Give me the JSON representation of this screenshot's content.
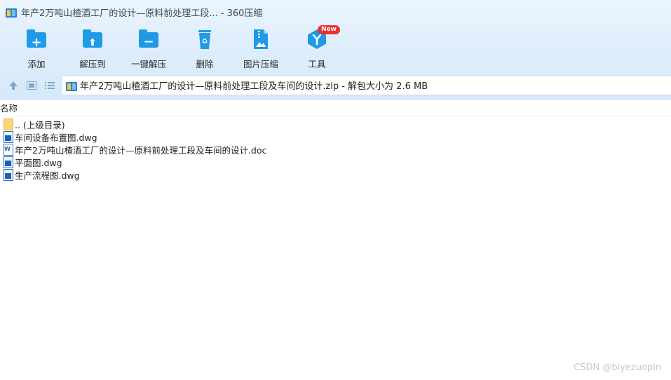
{
  "window": {
    "title": "年产2万吨山楂酒工厂的设计—原料前处理工段... - 360压缩"
  },
  "toolbar": {
    "items": [
      {
        "label": "添加",
        "icon": "add-folder-icon"
      },
      {
        "label": "解压到",
        "icon": "extract-to-folder-icon"
      },
      {
        "label": "一键解压",
        "icon": "one-click-extract-icon"
      },
      {
        "label": "删除",
        "icon": "recycle-bin-icon"
      },
      {
        "label": "图片压缩",
        "icon": "image-compress-icon"
      },
      {
        "label": "工具",
        "icon": "tools-icon",
        "badge": "New"
      }
    ]
  },
  "address": {
    "path": "年产2万吨山楂酒工厂的设计—原料前处理工段及车间的设计.zip - 解包大小为 2.6 MB"
  },
  "list": {
    "column_name": "名称",
    "rows": [
      {
        "name": ".. (上级目录)",
        "icon": "parent-folder-icon"
      },
      {
        "name": "车间设备布置图.dwg",
        "icon": "dwg-file-icon"
      },
      {
        "name": "年产2万吨山楂酒工厂的设计—原料前处理工段及车间的设计.doc",
        "icon": "doc-file-icon"
      },
      {
        "name": "平面图.dwg",
        "icon": "dwg-file-icon"
      },
      {
        "name": "生产流程图.dwg",
        "icon": "dwg-file-icon"
      }
    ]
  },
  "watermark": "CSDN @biyezuopin",
  "colors": {
    "accent": "#1e9ae6",
    "badge": "#e8322e",
    "chrome_top": "#eaf4fd",
    "chrome_bottom": "#d6e9fa"
  }
}
